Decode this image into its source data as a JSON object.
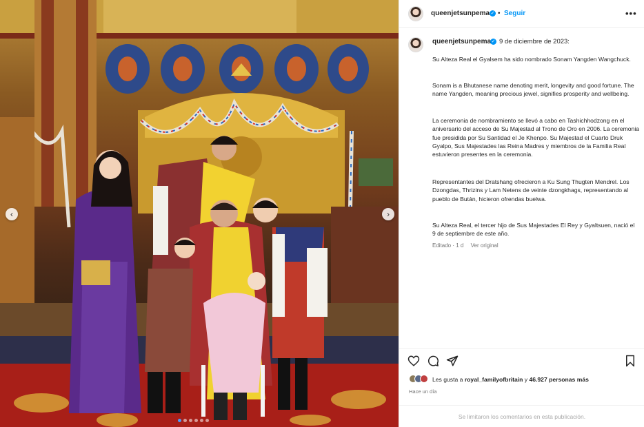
{
  "header": {
    "username": "queenjetsunpema",
    "separator": "•",
    "follow_label": "Seguir",
    "more_label": "•••"
  },
  "caption": {
    "username": "queenjetsunpema",
    "date": "9 de diciembre de 2023:",
    "paragraphs": [
      "Su Alteza Real el Gyalsem ha sido nombrado Sonam Yangden Wangchuck.",
      "Sonam is a Bhutanese name denoting merit, longevity and good fortune. The name Yangden, meaning precious jewel, signifies prosperity and wellbeing.",
      "La ceremonia de nombramiento se llevó a cabo en Tashichhodzong en el aniversario del acceso de Su Majestad al Trono de Oro en 2006. La ceremonia fue presidida por Su Santidad el Je Khenpo. Su Majestad el Cuarto Druk Gyalpo, Sus Majestades las Reina Madres y miembros de la Familia Real estuvieron presentes en la ceremonia.",
      "Representantes del Dratshang ofrecieron a Ku Sung Thugten Mendrel. Los Dzongdas, Thrizins y Lam Netens de veinte dzongkhags, representando al pueblo de Bután, hicieron ofrendas buelwa.",
      "Su Alteza Real, el tercer hijo de Sus Majestades El Rey y Gyaltsuen, nació el 9 de septiembre de este año."
    ],
    "edited": "Editado · 1 d",
    "see_original": "Ver original"
  },
  "actions": {
    "like_icon": "heart-icon",
    "comment_icon": "comment-icon",
    "share_icon": "share-icon",
    "save_icon": "bookmark-icon"
  },
  "likes": {
    "prefix": "Les gusta a",
    "user": "royal_familyofbritain",
    "middle": "y",
    "count": "46.927 personas más"
  },
  "posted_ago": "Hace un día",
  "comments_limited": "Se limitaron los comentarios en esta publicación.",
  "carousel": {
    "slide_count": 6,
    "active_slide": 1
  },
  "colors": {
    "accent": "#0095f6",
    "text": "#262626",
    "muted": "#737373"
  }
}
